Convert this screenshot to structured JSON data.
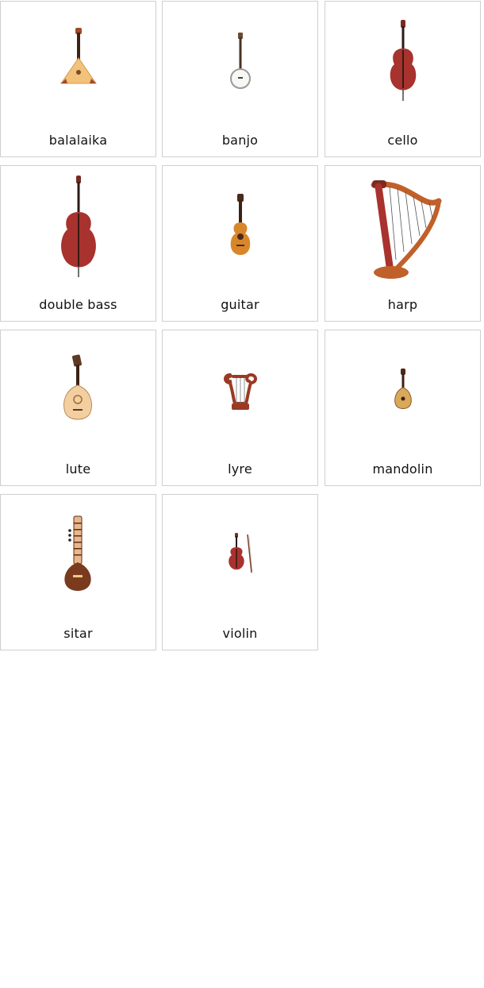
{
  "cards": [
    {
      "label": "balalaika",
      "icon": "balalaika-icon"
    },
    {
      "label": "banjo",
      "icon": "banjo-icon"
    },
    {
      "label": "cello",
      "icon": "cello-icon"
    },
    {
      "label": "double bass",
      "icon": "double-bass-icon"
    },
    {
      "label": "guitar",
      "icon": "guitar-icon"
    },
    {
      "label": "harp",
      "icon": "harp-icon"
    },
    {
      "label": "lute",
      "icon": "lute-icon"
    },
    {
      "label": "lyre",
      "icon": "lyre-icon"
    },
    {
      "label": "mandolin",
      "icon": "mandolin-icon"
    },
    {
      "label": "sitar",
      "icon": "sitar-icon"
    },
    {
      "label": "violin",
      "icon": "violin-icon"
    }
  ],
  "colors": {
    "wood_red": "#a8322e",
    "wood_orange": "#d9862a",
    "wood_light": "#f0c98a",
    "wood_dark": "#5e2a1c",
    "card_border": "#cfcfcf"
  }
}
